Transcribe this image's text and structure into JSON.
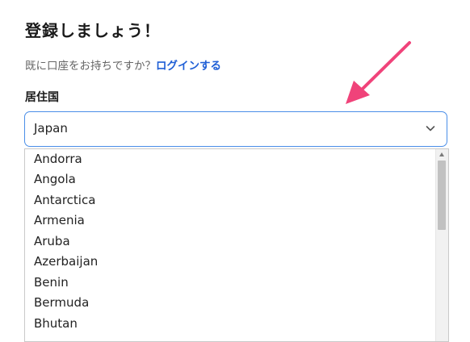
{
  "header": {
    "title": "登録しましょう！",
    "login_prompt": "既に口座をお持ちですか？",
    "login_link": "ログインする"
  },
  "form": {
    "country_label": "居住国",
    "selected_country": "Japan",
    "options": [
      "Andorra",
      "Angola",
      "Antarctica",
      "Armenia",
      "Aruba",
      "Azerbaijan",
      "Benin",
      "Bermuda",
      "Bhutan"
    ]
  },
  "colors": {
    "accent_link": "#1f5fd6",
    "focus_border": "#4a8ee8",
    "annotation_arrow": "#f0437a"
  }
}
